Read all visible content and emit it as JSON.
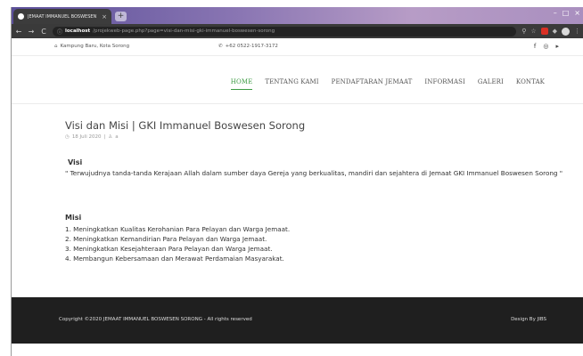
{
  "browser": {
    "tab_title": "JEMAAT IMMANUEL BOSWESEN",
    "tab_close": "×",
    "new_tab": "+",
    "url_host": "localhost",
    "url_path": "/projekweb-page.php?page=visi-dan-misi-gki-immanuel-boswesen-sorong"
  },
  "topbar": {
    "address": "Kampung Baru, Kota Sorong",
    "phone": "+62 0522-1917-3172"
  },
  "nav": {
    "items": [
      {
        "label": "HOME",
        "active": true
      },
      {
        "label": "TENTANG KAMI",
        "active": false
      },
      {
        "label": "PENDAFTARAN JEMAAT",
        "active": false
      },
      {
        "label": "INFORMASI",
        "active": false
      },
      {
        "label": "GALERI",
        "active": false
      },
      {
        "label": "KONTAK",
        "active": false
      }
    ]
  },
  "page": {
    "title": "Visi dan Misi | GKI Immanuel Boswesen Sorong",
    "date": "18 Juli 2020",
    "author": "a",
    "visi_heading": "Visi",
    "visi_text": "\" Terwujudnya tanda-tanda Kerajaan Allah dalam sumber daya Gereja yang berkualitas, mandiri dan sejahtera di Jemaat GKI Immanuel Boswesen Sorong \"",
    "misi_heading": "Misi",
    "misi_items": [
      "1. Meningkatkan Kualitas Kerohanian Para Pelayan dan Warga Jemaat.",
      "2. Meningkatkan Kemandirian Para Pelayan dan Warga Jemaat.",
      "3. Meningkatkan Kesejahteraan Para Pelayan dan Warga Jemaat.",
      "4. Membangun Kebersamaan dan Merawat Perdamaian Masyarakat."
    ]
  },
  "footer": {
    "copyright": "Copyright ©2020 JEMAAT IMMANUEL BOSWESEN SORONG - All rights reserved",
    "design": "Design By JIBS"
  },
  "colors": {
    "accent": "#3c9b43",
    "footer_bg": "#1f1f1f"
  },
  "icons": [
    "home-icon",
    "phone-icon",
    "facebook-icon",
    "instagram-icon",
    "youtube-icon",
    "clock-icon",
    "user-icon",
    "back-icon",
    "forward-icon",
    "reload-icon",
    "info-icon"
  ]
}
